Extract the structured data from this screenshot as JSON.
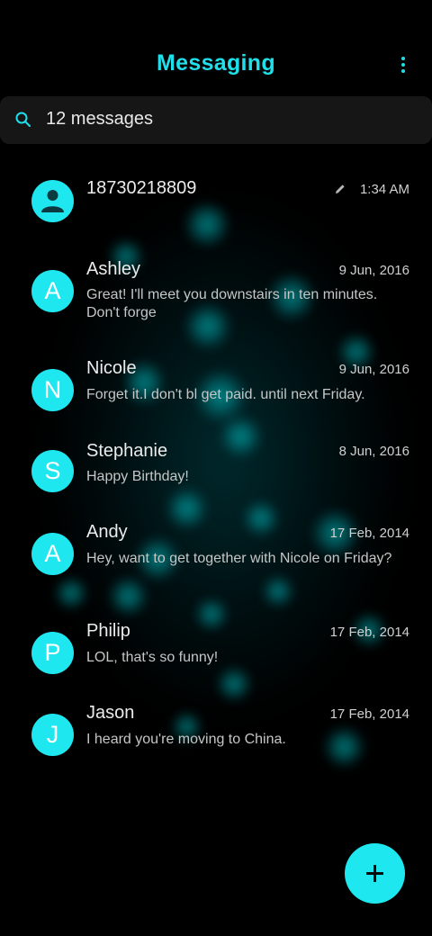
{
  "header": {
    "title": "Messaging"
  },
  "search": {
    "label": "12 messages"
  },
  "conversations": [
    {
      "avatar_letter": "",
      "avatar_icon": "person-icon",
      "name": "18730218809",
      "date": "1:34 AM",
      "snippet": "",
      "draft": true
    },
    {
      "avatar_letter": "A",
      "name": "Ashley",
      "date": "9 Jun, 2016",
      "snippet": "Great! I'll meet you downstairs in ten minutes. Don't forge"
    },
    {
      "avatar_letter": "N",
      "name": "Nicole",
      "date": "9 Jun, 2016",
      "snippet": "Forget it.I don't bl get paid. until next Friday."
    },
    {
      "avatar_letter": "S",
      "name": "Stephanie",
      "date": "8 Jun, 2016",
      "snippet": "Happy Birthday!"
    },
    {
      "avatar_letter": "A",
      "name": "Andy",
      "date": "17 Feb, 2014",
      "snippet": "Hey, want to get together with Nicole on Friday?"
    },
    {
      "avatar_letter": "P",
      "name": "Philip",
      "date": "17 Feb, 2014",
      "snippet": "LOL, that's so funny!"
    },
    {
      "avatar_letter": "J",
      "name": "Jason",
      "date": "17 Feb, 2014",
      "snippet": "I heard you're moving to China."
    }
  ],
  "colors": {
    "accent": "#1fe0ea",
    "background": "#000000",
    "search_background": "#161616"
  },
  "icons": {
    "menu": "more-vert-icon",
    "search": "search-icon",
    "draft": "pencil-icon",
    "compose": "plus-icon"
  }
}
